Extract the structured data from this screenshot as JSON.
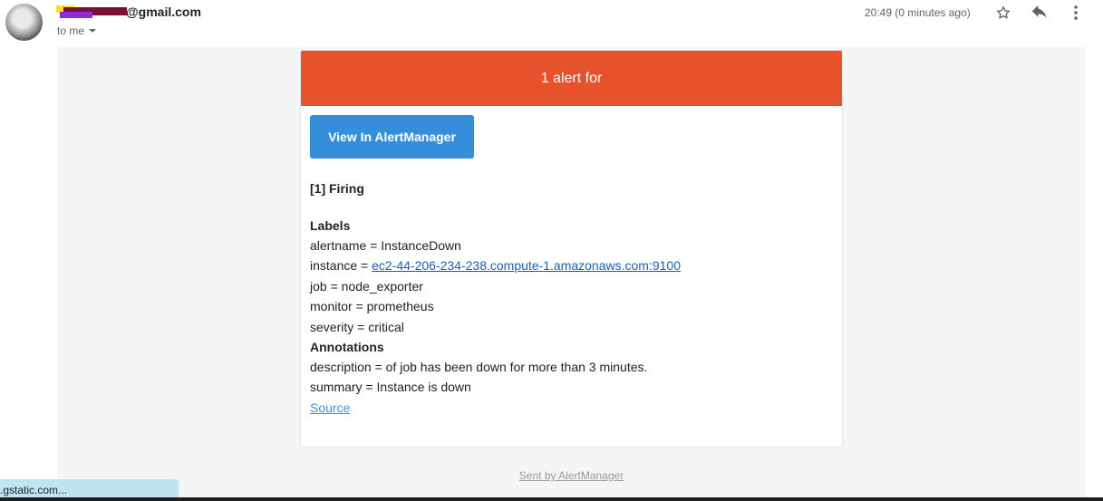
{
  "header": {
    "sender_visible": "@gmail.com",
    "to_me": "to me",
    "timestamp": "20:49 (0 minutes ago)",
    "icons": {
      "star": "star-icon",
      "reply": "reply-icon",
      "more": "more-vert-icon",
      "dropdown": "chevron-down-icon"
    }
  },
  "alert": {
    "header_title": "1 alert for",
    "button_label": "View In AlertManager",
    "firing": "[1] Firing",
    "labels_title": "Labels",
    "labels": {
      "alertname": "alertname = InstanceDown",
      "instance_prefix": "instance = ",
      "instance_link": "ec2-44-206-234-238.compute-1.amazonaws.com:9100",
      "job": "job = node_exporter",
      "monitor": "monitor = prometheus",
      "severity": "severity = critical"
    },
    "annotations_title": "Annotations",
    "annotations": {
      "description": "description = of job has been down for more than 3 minutes.",
      "summary": "summary = Instance is down"
    },
    "source_label": "Source"
  },
  "footer": {
    "sent_by": "Sent by AlertManager"
  },
  "status_bar": {
    "text": ".gstatic.com..."
  },
  "colors": {
    "alert_header": "#e6522c",
    "button": "#348eda",
    "body_background": "#f5f5f5",
    "status_bar": "#bfe5f2"
  }
}
